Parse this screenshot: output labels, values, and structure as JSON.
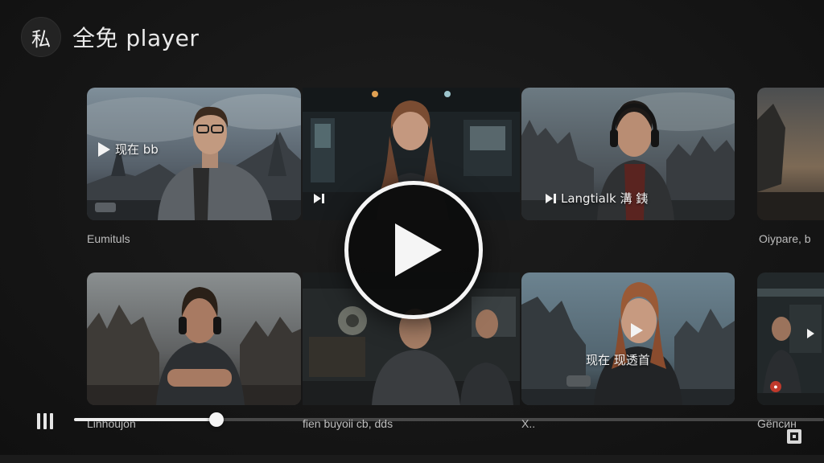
{
  "header": {
    "avatar_text": "私",
    "title": "全免 player"
  },
  "rows": [
    {
      "tiles": [
        {
          "label": "现在 bb",
          "caption": "Eumituls",
          "icon": "play-icon"
        },
        {
          "label": "",
          "caption": "",
          "icon": "skip-next-icon"
        },
        {
          "label": "Langtialk 溝 銕",
          "caption": "",
          "icon": "skip-play-icon"
        },
        {
          "label": "",
          "caption": "Oiypare, b",
          "icon": ""
        }
      ]
    },
    {
      "tiles": [
        {
          "label": "",
          "caption": "Linhoujon",
          "icon": ""
        },
        {
          "label": "",
          "caption": "fien buyoii cb, dds",
          "icon": ""
        },
        {
          "label": "现在  现透首",
          "caption": "X..",
          "icon": "play-icon"
        },
        {
          "label": "",
          "caption": "Gёпсин",
          "icon": "next-icon"
        }
      ]
    }
  ],
  "player": {
    "progress": 0.19,
    "big_play_icon": "play-icon",
    "pause_icon": "pause-icon",
    "fullscreen_icon": "fullscreen-icon"
  },
  "colors": {
    "background": "#161616",
    "accent": "#f5f5f5",
    "badge": "#c0392b"
  }
}
